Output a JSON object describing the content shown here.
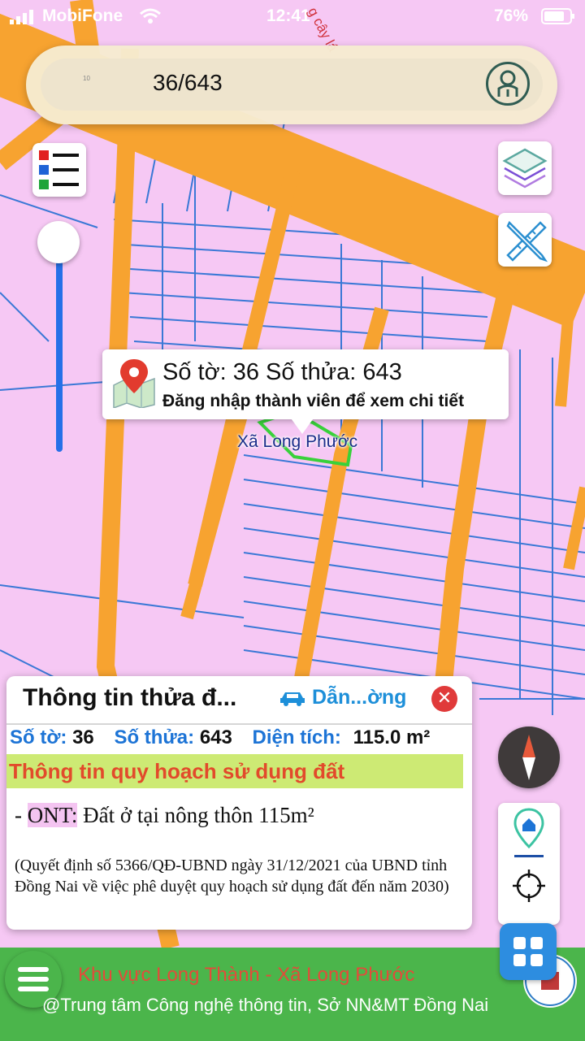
{
  "status_bar": {
    "carrier": "MobiFone",
    "time": "12:41",
    "battery": "76%"
  },
  "map": {
    "road_label_fragment": "g cây lá",
    "commune_label": "Xã Long Phước",
    "colors": {
      "land": "#f6c8f4",
      "road": "#f7a330",
      "parcel_line": "#3a78d6",
      "selected_parcel": "#38d13a"
    }
  },
  "search": {
    "query": "36/643",
    "hint": "10"
  },
  "popup": {
    "title": "Số tờ: 36 Số thửa: 643",
    "subtitle": "Đăng nhập thành viên để xem chi tiết"
  },
  "panel": {
    "title": "Thông tin thửa đ...",
    "directions_label": "Dẫn...ờng",
    "close_label": "✕",
    "sheet_label": "Số tờ:",
    "sheet_value": "36",
    "parcel_label": "Số thửa:",
    "parcel_value": "643",
    "area_label": "Diện tích:",
    "area_value": "115.0 m²",
    "plan_heading": "Thông tin quy hoạch sử dụng đất",
    "plan_prefix": "- ",
    "plan_code": "ONT:",
    "plan_text": " Đất ở tại nông thôn 115m²",
    "decision_note": "(Quyết định số 5366/QĐ-UBND ngày 31/12/2021 của UBND tỉnh Đồng Nai về việc phê duyệt quy hoạch sử dụng đất đến năm 2030)"
  },
  "zoom": {
    "level": 1.0
  },
  "icons": {
    "legend": "legend-list-icon",
    "layers": "layers-icon",
    "measure": "ruler-pencil-icon",
    "user": "user-icon",
    "pin": "map-pin-icon",
    "car": "car-icon",
    "compass": "compass-icon",
    "home_marker": "home-marker-icon",
    "locate": "crosshair-icon",
    "grid": "grid-icon",
    "menu": "menu-icon"
  },
  "footer": {
    "area": "Khu vực Long Thành - Xã Long Phước",
    "credit": "@Trung tâm Công nghệ thông tin, Sở NN&MT Đồng Nai"
  }
}
